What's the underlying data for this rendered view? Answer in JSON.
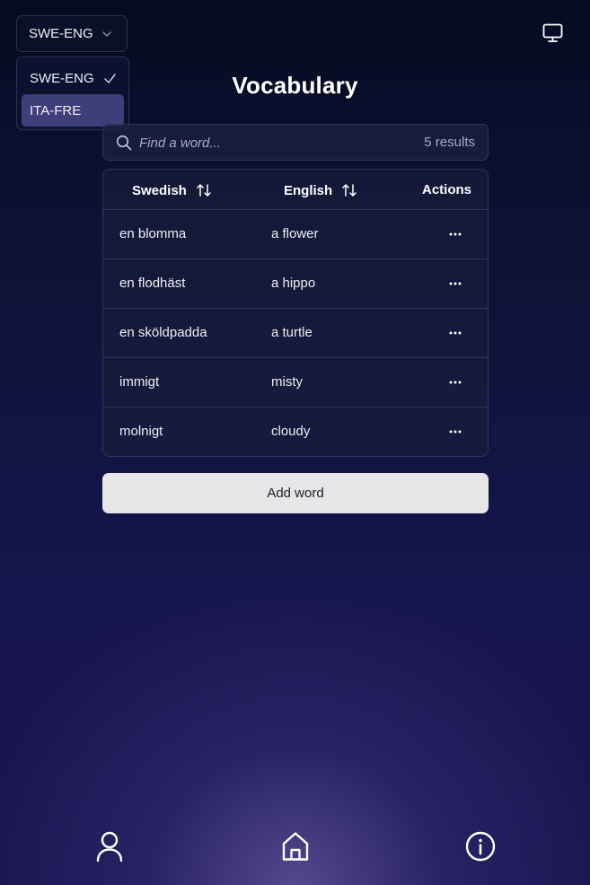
{
  "language_selector": {
    "selected": "SWE-ENG",
    "options": [
      {
        "label": "SWE-ENG",
        "checked": true
      },
      {
        "label": "ITA-FRE",
        "checked": false
      }
    ]
  },
  "header": {
    "title": "Vocabulary",
    "display_toggle_icon": "monitor-icon"
  },
  "search": {
    "placeholder": "Find a word...",
    "value": "",
    "results_text": "5 results"
  },
  "table": {
    "columns": {
      "source": "Swedish",
      "target": "English",
      "actions": "Actions"
    },
    "rows": [
      {
        "source": "en blomma",
        "target": "a flower"
      },
      {
        "source": "en flodhäst",
        "target": "a hippo"
      },
      {
        "source": "en sköldpadda",
        "target": "a turtle"
      },
      {
        "source": "immigt",
        "target": "misty"
      },
      {
        "source": "molnigt",
        "target": "cloudy"
      }
    ]
  },
  "add_button_label": "Add word",
  "bottom_nav": {
    "items": [
      {
        "icon": "user-icon"
      },
      {
        "icon": "home-icon"
      },
      {
        "icon": "info-icon"
      }
    ]
  },
  "colors": {
    "background_top": "#050b22",
    "background_bottom": "#1a1452",
    "accent_highlight": "#3f3d7a",
    "button_background": "#e6e6e8"
  }
}
